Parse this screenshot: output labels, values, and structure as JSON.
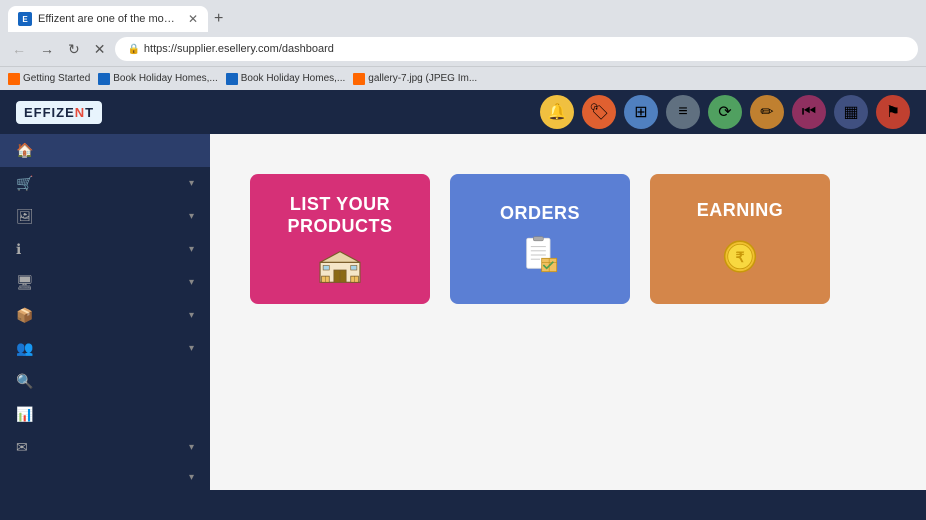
{
  "browser": {
    "tab": {
      "title": "Effizent are one of the most tr...",
      "favicon_letter": "E"
    },
    "new_tab_label": "+",
    "address": "https://supplier.esellery.com/dashboard",
    "bookmarks": [
      {
        "label": "Getting Started",
        "icon_color": "orange"
      },
      {
        "label": "Book Holiday Homes,...",
        "icon_color": "blue"
      },
      {
        "label": "Book Holiday Homes,...",
        "icon_color": "blue"
      },
      {
        "label": "gallery-7.jpg (JPEG Im...",
        "icon_color": "orange"
      }
    ]
  },
  "topnav": {
    "logo_text_1": "EFFIZE",
    "logo_text_highlight": "N",
    "logo_text_2": "T",
    "nav_icons": [
      {
        "name": "bell-icon",
        "color": "#f0c040",
        "symbol": "🔔"
      },
      {
        "name": "tag-icon",
        "color": "#e06030",
        "symbol": "🏷"
      },
      {
        "name": "grid-icon",
        "color": "#5080c0",
        "symbol": "⊞"
      },
      {
        "name": "menu-icon",
        "color": "#607080",
        "symbol": "≡"
      },
      {
        "name": "sync-icon",
        "color": "#50a060",
        "symbol": "⟳"
      },
      {
        "name": "edit-icon",
        "color": "#c08030",
        "symbol": "✏"
      },
      {
        "name": "skip-icon",
        "color": "#903060",
        "symbol": "⏮"
      },
      {
        "name": "bars-icon",
        "color": "#405080",
        "symbol": "▦"
      },
      {
        "name": "flag-icon",
        "color": "#c04030",
        "symbol": "⚑"
      }
    ]
  },
  "sidebar": {
    "items": [
      {
        "id": "home",
        "icon": "🏠",
        "label": "",
        "has_chevron": false,
        "active": true
      },
      {
        "id": "shop",
        "icon": "🛒",
        "label": "",
        "has_chevron": true,
        "active": false
      },
      {
        "id": "image",
        "icon": "🖼",
        "label": "",
        "has_chevron": true,
        "active": false
      },
      {
        "id": "tag",
        "icon": "ℹ",
        "label": "",
        "has_chevron": true,
        "active": false
      },
      {
        "id": "monitor",
        "icon": "🖥",
        "label": "",
        "has_chevron": true,
        "active": false
      },
      {
        "id": "box",
        "icon": "📦",
        "label": "",
        "has_chevron": true,
        "active": false
      },
      {
        "id": "users",
        "icon": "👥",
        "label": "",
        "has_chevron": true,
        "active": false
      },
      {
        "id": "search",
        "icon": "🔍",
        "label": "",
        "has_chevron": false,
        "active": false
      },
      {
        "id": "chart",
        "icon": "📊",
        "label": "",
        "has_chevron": false,
        "active": false
      },
      {
        "id": "mail",
        "icon": "✉",
        "label": "",
        "has_chevron": true,
        "active": false
      },
      {
        "id": "more",
        "icon": "",
        "label": "",
        "has_chevron": true,
        "active": false
      }
    ]
  },
  "dashboard": {
    "cards": [
      {
        "id": "list-products",
        "title": "LIST YOUR PRODUCTS",
        "bg_color": "#d63077",
        "icon_type": "warehouse"
      },
      {
        "id": "orders",
        "title": "ORDERS",
        "bg_color": "#5b7fd4",
        "icon_type": "orders"
      },
      {
        "id": "earning",
        "title": "EARNING",
        "bg_color": "#d4864a",
        "icon_type": "coin"
      }
    ]
  }
}
